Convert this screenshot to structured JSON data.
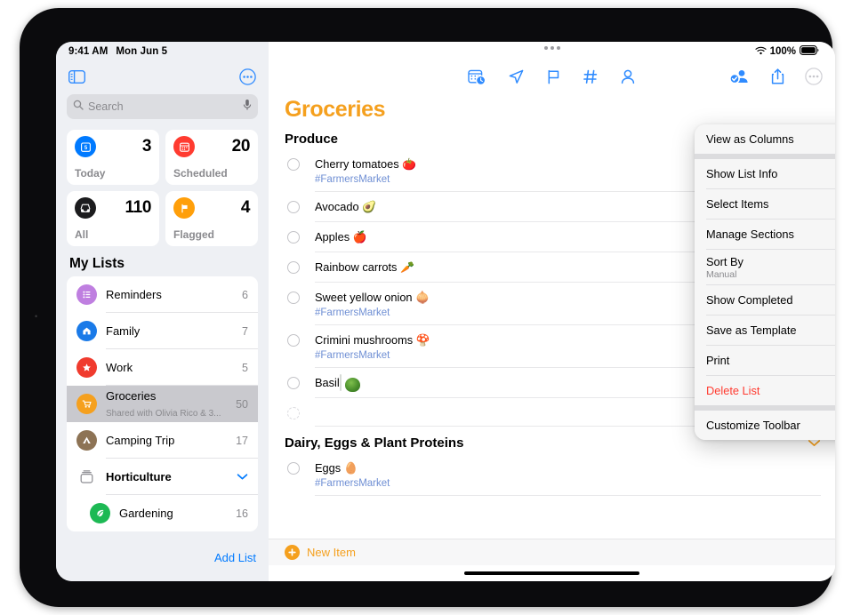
{
  "statusbar": {
    "time": "9:41 AM",
    "date": "Mon Jun 5",
    "battery_percent": "100%",
    "wifi_icon": "wifi-icon",
    "battery_icon": "battery-full-icon"
  },
  "sidebar": {
    "toggle_icon": "sidebar-toggle-icon",
    "more_icon": "more-circle-icon",
    "search": {
      "placeholder": "Search",
      "icon": "search-icon",
      "mic_icon": "microphone-icon"
    },
    "smart_lists": [
      {
        "label": "Today",
        "count": "3",
        "icon": "today-calendar-icon",
        "color": "#007aff"
      },
      {
        "label": "Scheduled",
        "count": "20",
        "icon": "scheduled-calendar-icon",
        "color": "#ff3b30"
      },
      {
        "label": "All",
        "count": "110",
        "icon": "all-inbox-icon",
        "color": "#1c1c1e"
      },
      {
        "label": "Flagged",
        "count": "4",
        "icon": "flag-icon",
        "color": "#ff9f0a"
      }
    ],
    "my_lists_title": "My Lists",
    "lists": [
      {
        "name": "Reminders",
        "count": "6",
        "icon": "list-bullet-icon",
        "color": "#bf7fe0",
        "sub": "",
        "selected": false,
        "group": false,
        "indent": false
      },
      {
        "name": "Family",
        "count": "7",
        "icon": "house-icon",
        "color": "#1a7ae8",
        "sub": "",
        "selected": false,
        "group": false,
        "indent": false
      },
      {
        "name": "Work",
        "count": "5",
        "icon": "star-icon",
        "color": "#f03b2e",
        "sub": "",
        "selected": false,
        "group": false,
        "indent": false
      },
      {
        "name": "Groceries",
        "count": "50",
        "icon": "cart-icon",
        "color": "#f5a01e",
        "sub": "Shared with Olivia Rico & 3...",
        "selected": true,
        "group": false,
        "indent": false
      },
      {
        "name": "Camping Trip",
        "count": "17",
        "icon": "tent-icon",
        "color": "#8d7355",
        "sub": "",
        "selected": false,
        "group": false,
        "indent": false
      },
      {
        "name": "Horticulture",
        "count": "",
        "icon": "folder-group-icon",
        "color": "#8e8e93",
        "sub": "",
        "selected": false,
        "group": true,
        "indent": false
      },
      {
        "name": "Gardening",
        "count": "16",
        "icon": "leaf-icon",
        "color": "#1db954",
        "sub": "",
        "selected": false,
        "group": false,
        "indent": true
      }
    ],
    "add_list_label": "Add List"
  },
  "toolbar": {
    "center_icons": [
      "today-calendar-clock-icon",
      "location-arrow-icon",
      "flag-outline-icon",
      "hashtag-icon",
      "person-icon"
    ],
    "right_icons": [
      "share-person-check-icon",
      "share-upload-icon",
      "more-circle-icon"
    ]
  },
  "main": {
    "title": "Groceries",
    "title_color": "#f5a01e",
    "sections": [
      {
        "name": "Produce",
        "collapsible": false,
        "items": [
          {
            "title": "Cherry tomatoes 🍅",
            "tag": "#FarmersMarket",
            "thumb": false,
            "empty": false
          },
          {
            "title": "Avocado 🥑",
            "tag": "",
            "thumb": false,
            "empty": false
          },
          {
            "title": "Apples 🍎",
            "tag": "",
            "thumb": false,
            "empty": false
          },
          {
            "title": "Rainbow carrots 🥕",
            "tag": "",
            "thumb": false,
            "empty": false
          },
          {
            "title": "Sweet yellow onion 🧅",
            "tag": "#FarmersMarket",
            "thumb": false,
            "empty": false
          },
          {
            "title": "Crimini mushrooms 🍄",
            "tag": "#FarmersMarket",
            "thumb": false,
            "empty": false
          },
          {
            "title": "Basil",
            "tag": "",
            "thumb": true,
            "empty": false
          },
          {
            "title": "",
            "tag": "",
            "thumb": false,
            "empty": true
          }
        ]
      },
      {
        "name": "Dairy, Eggs & Plant Proteins",
        "collapsible": true,
        "items": [
          {
            "title": "Eggs 🥚",
            "tag": "#FarmersMarket",
            "thumb": false,
            "empty": false
          }
        ]
      }
    ],
    "new_item_label": "New Item"
  },
  "context_menu": {
    "items": [
      {
        "label": "View as Columns",
        "sub": "",
        "icon": "view-columns-icon",
        "chevron": false,
        "danger": false,
        "gap_after": true
      },
      {
        "label": "Show List Info",
        "sub": "",
        "icon": "info-circle-icon",
        "chevron": false,
        "danger": false,
        "gap_after": false
      },
      {
        "label": "Select Items",
        "sub": "",
        "icon": "checkmark-circle-icon",
        "chevron": false,
        "danger": false,
        "gap_after": false
      },
      {
        "label": "Manage Sections",
        "sub": "",
        "icon": "manage-sections-icon",
        "chevron": true,
        "danger": false,
        "gap_after": false
      },
      {
        "label": "Sort By",
        "sub": "Manual",
        "icon": "sort-arrows-icon",
        "chevron": true,
        "danger": false,
        "gap_after": false
      },
      {
        "label": "Show Completed",
        "sub": "",
        "icon": "eye-icon",
        "chevron": false,
        "danger": false,
        "gap_after": false
      },
      {
        "label": "Save as Template",
        "sub": "",
        "icon": "save-template-icon",
        "chevron": false,
        "danger": false,
        "gap_after": false
      },
      {
        "label": "Print",
        "sub": "",
        "icon": "printer-icon",
        "chevron": false,
        "danger": false,
        "gap_after": false
      },
      {
        "label": "Delete List",
        "sub": "",
        "icon": "trash-icon",
        "chevron": false,
        "danger": true,
        "gap_after": true
      },
      {
        "label": "Customize Toolbar",
        "sub": "",
        "icon": "wrench-icon",
        "chevron": false,
        "danger": false,
        "gap_after": false
      }
    ]
  }
}
